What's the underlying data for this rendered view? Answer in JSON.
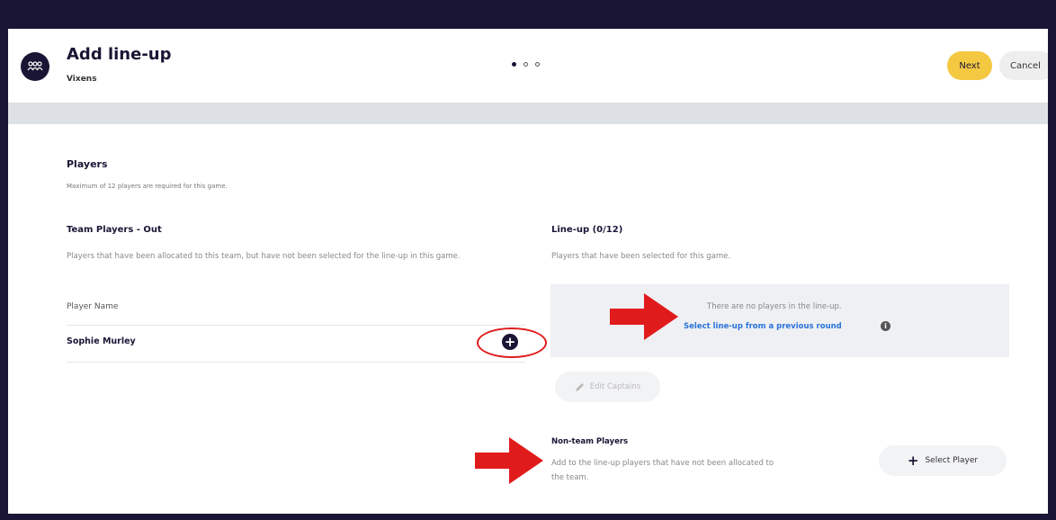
{
  "header": {
    "title": "Add line-up",
    "subtitle": "Vixens",
    "steps": {
      "total": 3,
      "current": 1
    },
    "next_label": "Next",
    "cancel_label": "Cancel"
  },
  "players_section": {
    "title": "Players",
    "description": "Maximum of 12 players are required for this game."
  },
  "team_out": {
    "title": "Team Players - Out",
    "description": "Players that have been allocated to this team, but have not been selected for the line-up in this game.",
    "column_header": "Player Name",
    "players": [
      {
        "name": "Sophie Murley"
      }
    ]
  },
  "lineup": {
    "title": "Line-up (0/12)",
    "description": "Players that have been selected for this game.",
    "empty_text": "There are no players in the line-up.",
    "previous_round_link": "Select line-up from a previous round",
    "edit_captains_label": "Edit Captains"
  },
  "non_team": {
    "title": "Non-team Players",
    "description": "Add to the line-up players that have not been allocated to the team.",
    "select_label": "Select Player"
  },
  "colors": {
    "accent_yellow": "#f5c842",
    "dark_navy": "#1b1535",
    "link_blue": "#2a73d9",
    "annotation_red": "#e01b1b"
  },
  "icons": [
    "team-icon",
    "plus-circle-icon",
    "info-icon",
    "pencil-icon",
    "plus-icon",
    "red-arrow-icon"
  ]
}
